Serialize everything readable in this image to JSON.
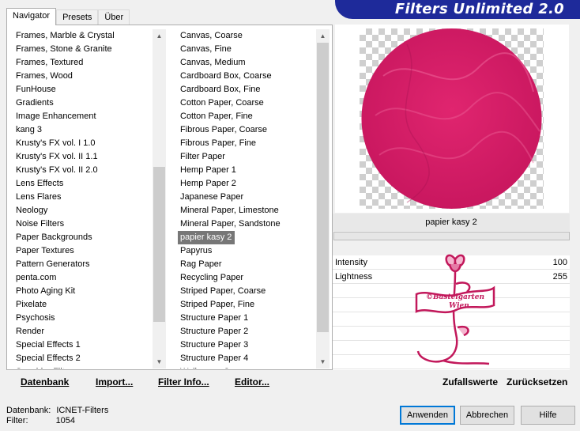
{
  "tabs": [
    {
      "label": "Navigator",
      "active": true
    },
    {
      "label": "Presets",
      "active": false
    },
    {
      "label": "Über",
      "active": false
    }
  ],
  "banner": {
    "title": "Filters Unlimited 2.0",
    "color": "#1e2a9a"
  },
  "categories": [
    "Frames, Marble & Crystal",
    "Frames, Stone & Granite",
    "Frames, Textured",
    "Frames, Wood",
    "FunHouse",
    "Gradients",
    "Image Enhancement",
    "kang 3",
    "Krusty's FX vol. I 1.0",
    "Krusty's FX vol. II 1.1",
    "Krusty's FX vol. II 2.0",
    "Lens Effects",
    "Lens Flares",
    "Neology",
    "Noise Filters",
    "Paper Backgrounds",
    "Paper Textures",
    "Pattern Generators",
    "penta.com",
    "Photo Aging Kit",
    "Pixelate",
    "Psychosis",
    "Render",
    "Special Effects 1",
    "Special Effects 2",
    "Sapphire Filters"
  ],
  "filters": [
    "Canvas, Coarse",
    "Canvas, Fine",
    "Canvas, Medium",
    "Cardboard Box, Coarse",
    "Cardboard Box, Fine",
    "Cotton Paper, Coarse",
    "Cotton Paper, Fine",
    "Fibrous Paper, Coarse",
    "Fibrous Paper, Fine",
    "Filter Paper",
    "Hemp Paper 1",
    "Hemp Paper 2",
    "Japanese Paper",
    "Mineral Paper, Limestone",
    "Mineral Paper, Sandstone",
    "papier kasy 2",
    "Papyrus",
    "Rag Paper",
    "Recycling Paper",
    "Striped Paper, Coarse",
    "Striped Paper, Fine",
    "Structure Paper 1",
    "Structure Paper 2",
    "Structure Paper 3",
    "Structure Paper 4",
    "Wallpaper, Coarse"
  ],
  "selected_filter_index": 15,
  "preview": {
    "filter_name": "papier kasy 2",
    "progress": 0.0,
    "disc_color": "#d81b6f"
  },
  "params": [
    {
      "label": "Intensity",
      "value": "100"
    },
    {
      "label": "Lightness",
      "value": "255"
    }
  ],
  "watermark": {
    "line1": "©Bastelgarten",
    "line2": "Wien",
    "color": "#c2185b"
  },
  "toolbar": {
    "database": "Datenbank",
    "import": "Import...",
    "filter_info": "Filter Info...",
    "editor": "Editor...",
    "random": "Zufallswerte",
    "reset": "Zurücksetzen"
  },
  "buttons": {
    "apply": "Anwenden",
    "cancel": "Abbrechen",
    "help": "Hilfe"
  },
  "status": {
    "db_label": "Datenbank:",
    "db_value": "ICNET-Filters",
    "filter_label": "Filter:",
    "filter_value": "1054"
  }
}
